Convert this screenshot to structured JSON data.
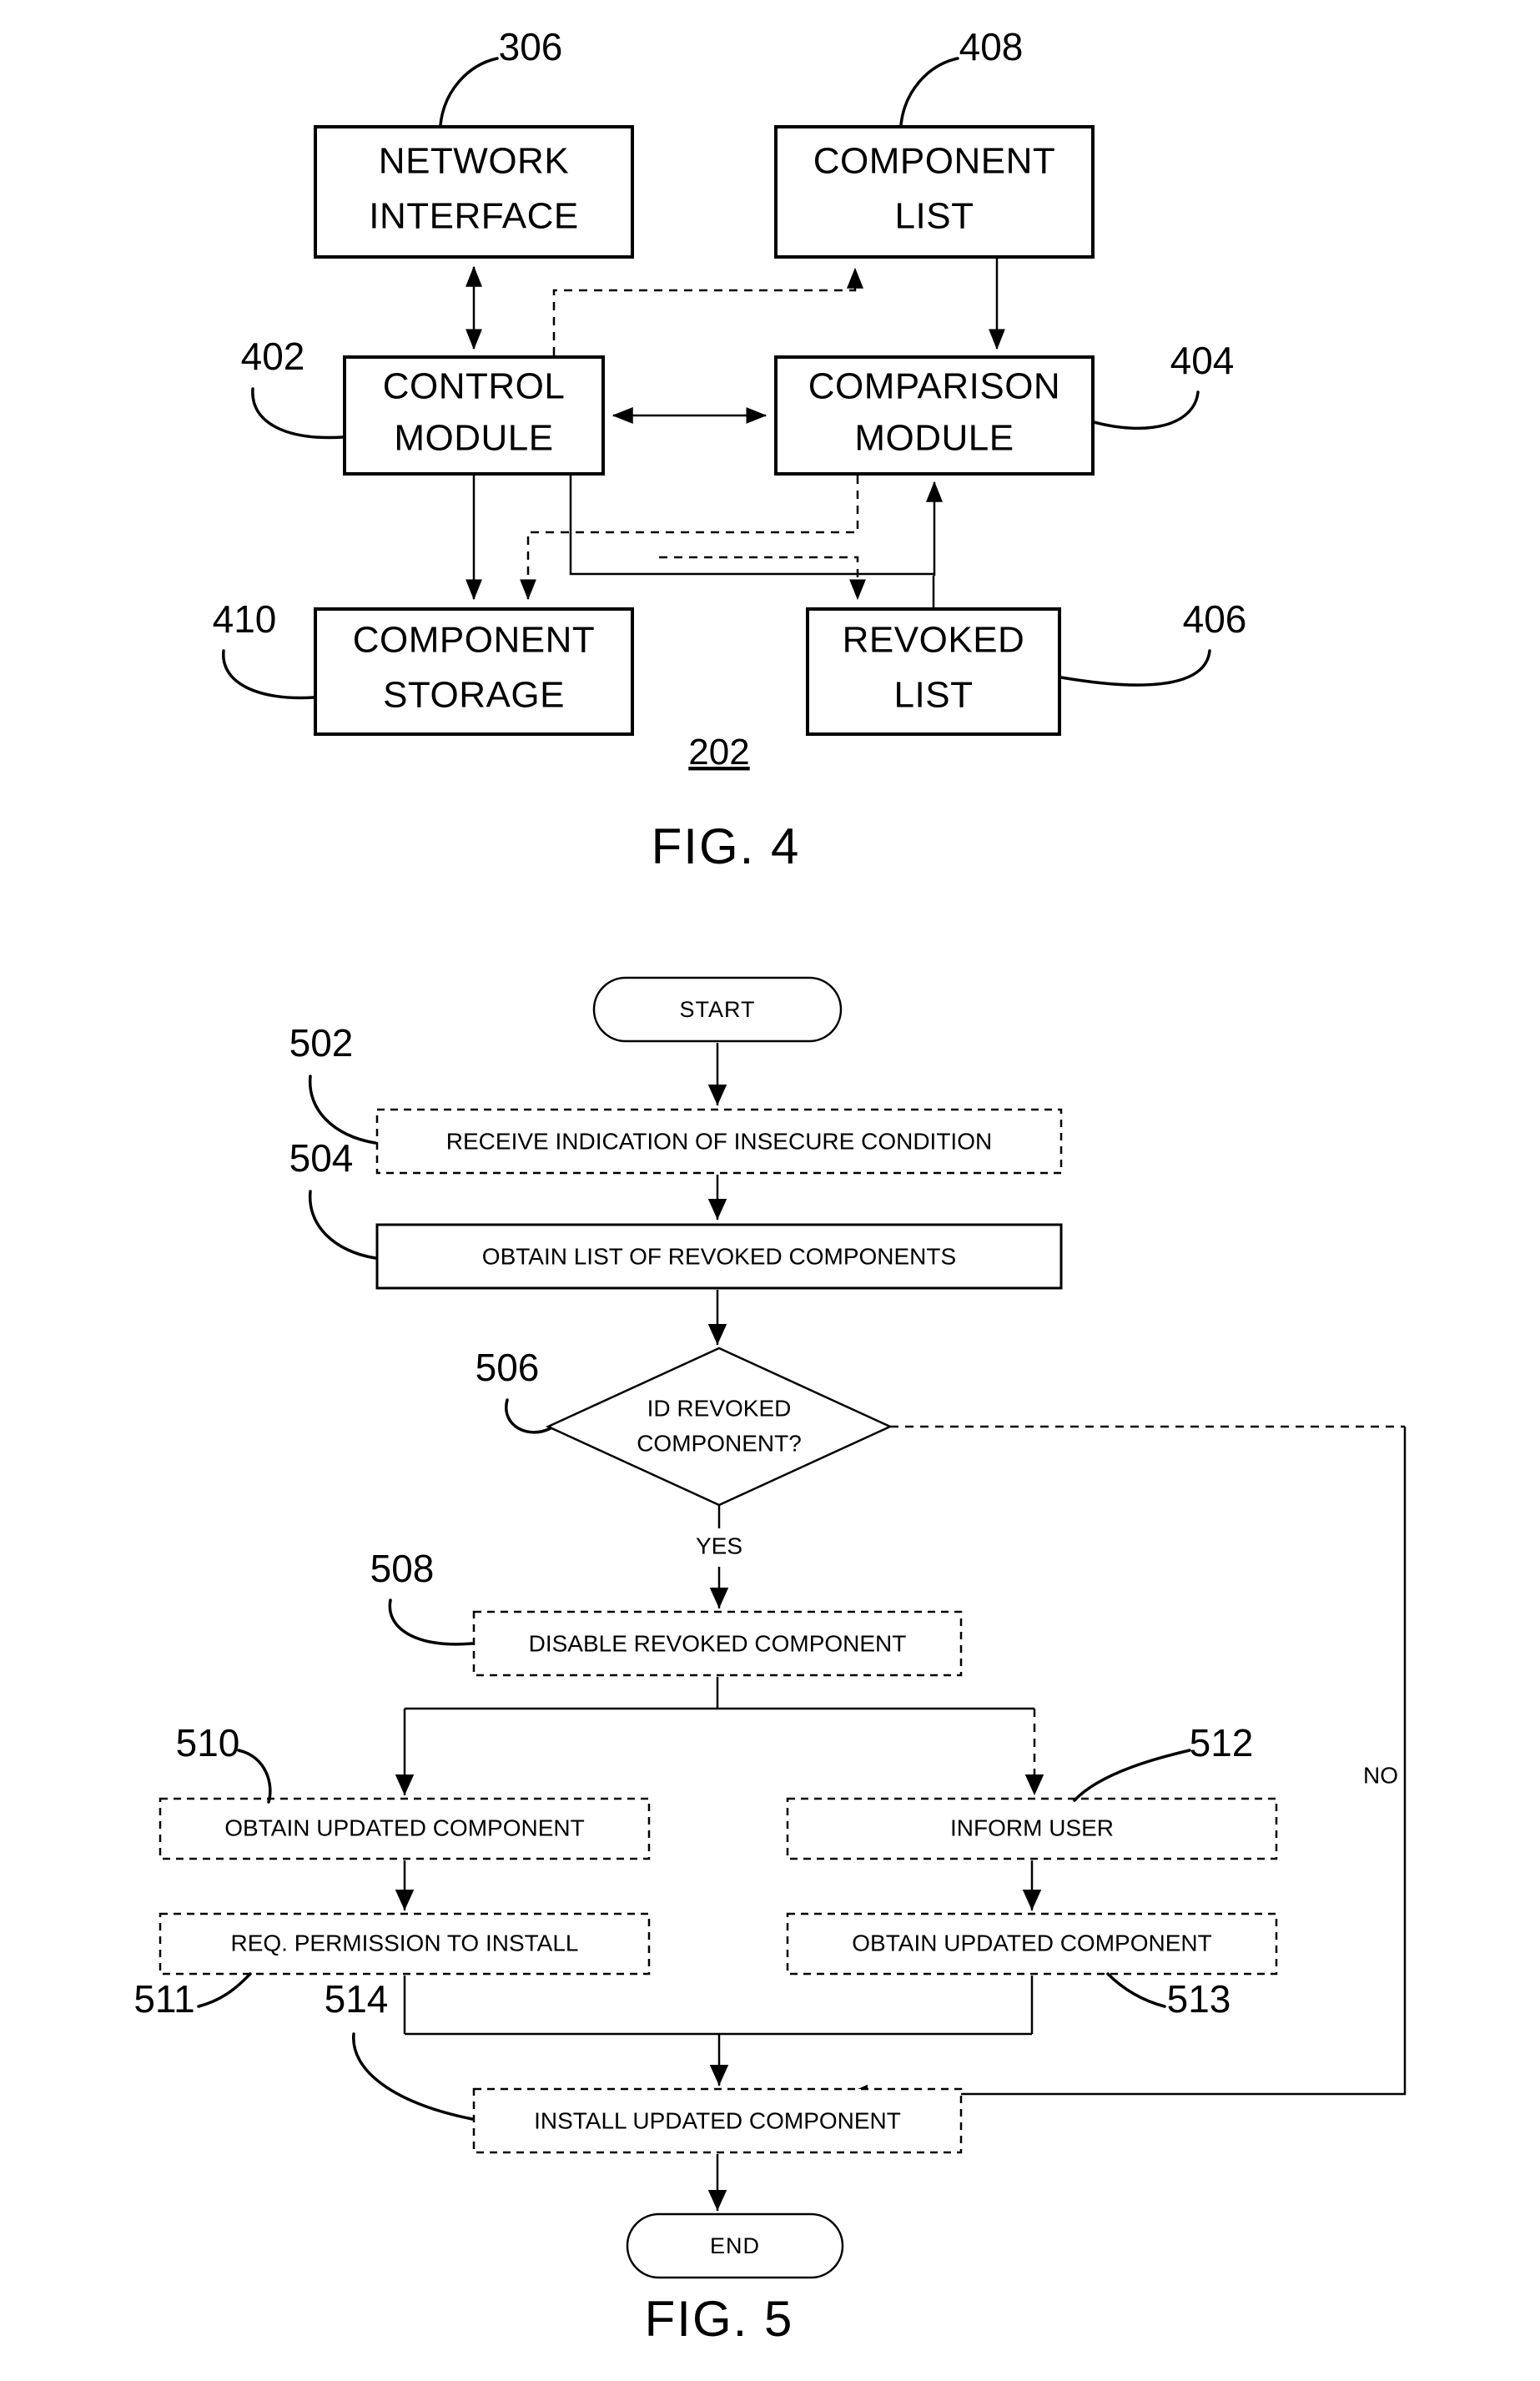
{
  "document": {
    "type": "patent-drawing-sheet",
    "figures": [
      "FIG. 4",
      "FIG. 5"
    ]
  },
  "fig4": {
    "caption": "FIG. 4",
    "system_ref": "202",
    "blocks": [
      {
        "id": "network-interface",
        "label_line1": "NETWORK",
        "label_line2": "INTERFACE",
        "ref": "306"
      },
      {
        "id": "component-list",
        "label_line1": "COMPONENT",
        "label_line2": "LIST",
        "ref": "408"
      },
      {
        "id": "control-module",
        "label_line1": "CONTROL",
        "label_line2": "MODULE",
        "ref": "402"
      },
      {
        "id": "comparison-module",
        "label_line1": "COMPARISON",
        "label_line2": "MODULE",
        "ref": "404"
      },
      {
        "id": "component-storage",
        "label_line1": "COMPONENT",
        "label_line2": "STORAGE",
        "ref": "410"
      },
      {
        "id": "revoked-list",
        "label_line1": "REVOKED",
        "label_line2": "LIST",
        "ref": "406"
      }
    ]
  },
  "fig5": {
    "caption": "FIG. 5",
    "nodes": [
      {
        "id": "start",
        "ref": "",
        "label": "START",
        "shape": "terminal",
        "border": "solid"
      },
      {
        "id": "step502",
        "ref": "502",
        "label": "RECEIVE INDICATION OF INSECURE CONDITION",
        "shape": "process",
        "border": "dashed"
      },
      {
        "id": "step504",
        "ref": "504",
        "label": "OBTAIN LIST OF REVOKED COMPONENTS",
        "shape": "process",
        "border": "solid"
      },
      {
        "id": "step506",
        "ref": "506",
        "label_line1": "ID REVOKED",
        "label_line2": "COMPONENT?",
        "shape": "decision",
        "border": "solid"
      },
      {
        "id": "step508",
        "ref": "508",
        "label": "DISABLE REVOKED COMPONENT",
        "shape": "process",
        "border": "dashed"
      },
      {
        "id": "step510",
        "ref": "510",
        "label": "OBTAIN UPDATED COMPONENT",
        "shape": "process",
        "border": "dashed"
      },
      {
        "id": "step512",
        "ref": "512",
        "label": "INFORM USER",
        "shape": "process",
        "border": "dashed"
      },
      {
        "id": "step511",
        "ref": "511",
        "label": "REQ. PERMISSION TO INSTALL",
        "shape": "process",
        "border": "dashed"
      },
      {
        "id": "step513",
        "ref": "513",
        "label": "OBTAIN UPDATED COMPONENT",
        "shape": "process",
        "border": "dashed"
      },
      {
        "id": "step514",
        "ref": "514",
        "label": "INSTALL UPDATED COMPONENT",
        "shape": "process",
        "border": "dashed"
      },
      {
        "id": "end",
        "ref": "",
        "label": "END",
        "shape": "terminal",
        "border": "solid"
      }
    ],
    "edge_labels": {
      "yes": "YES",
      "no": "NO"
    }
  }
}
